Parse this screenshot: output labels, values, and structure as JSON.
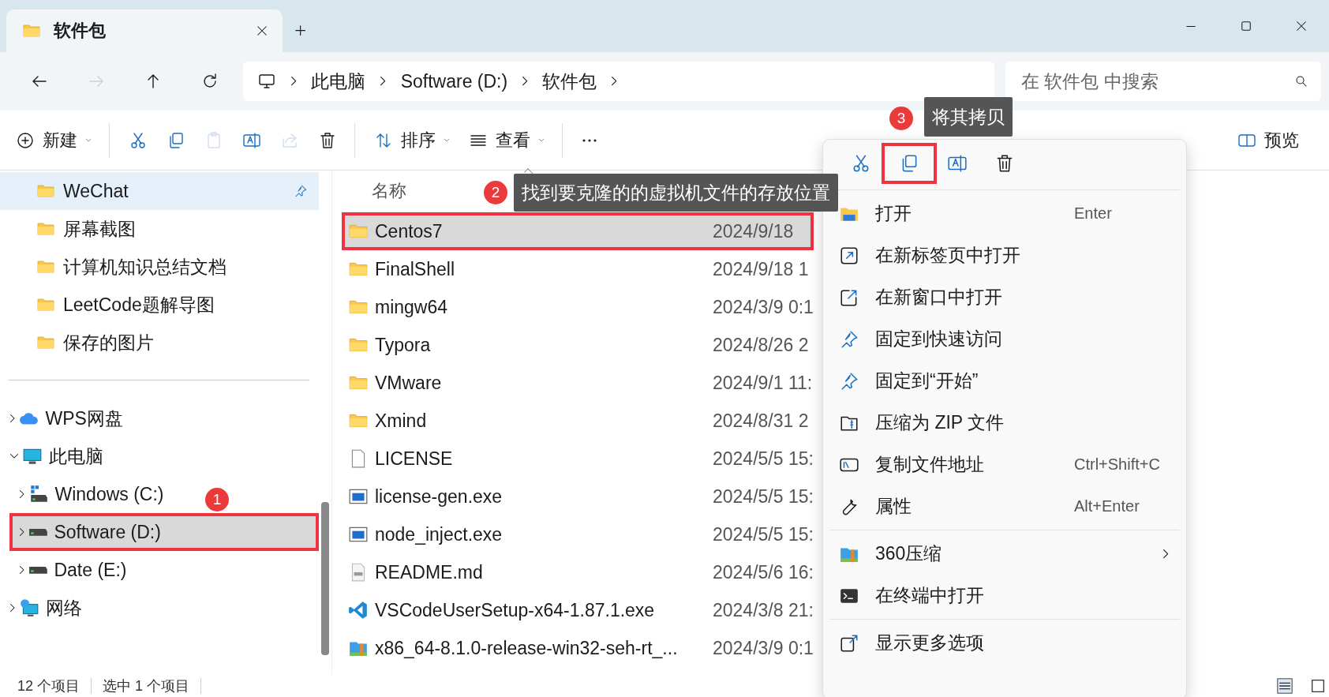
{
  "tabs": [
    {
      "label": "软件包",
      "selected": true
    }
  ],
  "address": {
    "segments": [
      "此电脑",
      "Software (D:)",
      "软件包"
    ],
    "search_placeholder": "在 软件包 中搜索"
  },
  "nav_buttons": [
    {
      "kind": "back",
      "disabled": false
    },
    {
      "kind": "forward",
      "disabled": true
    },
    {
      "kind": "up",
      "disabled": false
    },
    {
      "kind": "refresh",
      "disabled": false
    }
  ],
  "toolbar": [
    {
      "kind": "new",
      "label": "新建",
      "disabled": false
    },
    {
      "kind": "divider"
    },
    {
      "kind": "cut",
      "disabled": false
    },
    {
      "kind": "copy",
      "disabled": false
    },
    {
      "kind": "paste",
      "disabled": true
    },
    {
      "kind": "rename",
      "disabled": false
    },
    {
      "kind": "share",
      "disabled": true
    },
    {
      "kind": "delete",
      "disabled": false
    },
    {
      "kind": "divider"
    },
    {
      "kind": "sort",
      "label": "排序",
      "disabled": false
    },
    {
      "kind": "view",
      "label": "查看",
      "disabled": false
    },
    {
      "kind": "divider"
    },
    {
      "kind": "more",
      "disabled": false
    }
  ],
  "preview_button": {
    "label": "预览"
  },
  "sidebar": {
    "quick_access": [
      {
        "label": "WeChat",
        "pinned": true,
        "selected": true
      },
      {
        "label": "屏幕截图",
        "pinned": false,
        "selected": false
      },
      {
        "label": "计算机知识总结文档",
        "pinned": false,
        "selected": false
      },
      {
        "label": "LeetCode题解导图",
        "pinned": false,
        "selected": false
      },
      {
        "label": "保存的图片",
        "pinned": false,
        "selected": false
      }
    ],
    "tree": [
      {
        "label": "WPS网盘",
        "kind": "cloud",
        "expanded": false,
        "selected": false,
        "marked": false
      },
      {
        "label": "此电脑",
        "kind": "pc",
        "expanded": true,
        "selected": false,
        "marked": false,
        "children": [
          {
            "label": "Windows  (C:)",
            "kind": "system-drive",
            "expanded": false,
            "selected": false,
            "marked": false
          },
          {
            "label": "Software (D:)",
            "kind": "drive",
            "expanded": false,
            "selected": true,
            "marked": true,
            "callout": {
              "number": "1"
            }
          },
          {
            "label": "Date (E:)",
            "kind": "drive",
            "expanded": false,
            "selected": false,
            "marked": false
          }
        ]
      },
      {
        "label": "网络",
        "kind": "network",
        "expanded": false,
        "selected": false,
        "marked": false
      }
    ]
  },
  "file_list": {
    "columns": [
      "名称"
    ],
    "rows": [
      {
        "name": "Centos7",
        "kind": "folder",
        "date": "2024/9/18",
        "selected": true,
        "marked": true,
        "callout": {
          "number": "2",
          "text": "找到要克隆的的虚拟机文件的存放位置"
        }
      },
      {
        "name": "FinalShell",
        "kind": "folder",
        "date": "2024/9/18 1",
        "selected": false,
        "marked": false
      },
      {
        "name": "mingw64",
        "kind": "folder",
        "date": "2024/3/9 0:1",
        "selected": false,
        "marked": false
      },
      {
        "name": "Typora",
        "kind": "folder",
        "date": "2024/8/26 2",
        "selected": false,
        "marked": false
      },
      {
        "name": "VMware",
        "kind": "folder",
        "date": "2024/9/1 11:",
        "selected": false,
        "marked": false
      },
      {
        "name": "Xmind",
        "kind": "folder",
        "date": "2024/8/31 2",
        "selected": false,
        "marked": false
      },
      {
        "name": "LICENSE",
        "kind": "file",
        "date": "2024/5/5 15:",
        "selected": false,
        "marked": false
      },
      {
        "name": "license-gen.exe",
        "kind": "program",
        "date": "2024/5/5 15:",
        "selected": false,
        "marked": false
      },
      {
        "name": "node_inject.exe",
        "kind": "program",
        "date": "2024/5/5 15:",
        "selected": false,
        "marked": false
      },
      {
        "name": "README.md",
        "kind": "markdown",
        "date": "2024/5/6 16:",
        "selected": false,
        "marked": false
      },
      {
        "name": "VSCodeUserSetup-x64-1.87.1.exe",
        "kind": "installer",
        "date": "2024/3/8 21:",
        "selected": false,
        "marked": false
      },
      {
        "name": "x86_64-8.1.0-release-win32-seh-rt_...",
        "kind": "archive",
        "date": "2024/3/9 0:1",
        "selected": false,
        "marked": false
      }
    ]
  },
  "context_menu": {
    "actions": [
      {
        "kind": "cut",
        "marked": false
      },
      {
        "kind": "copy",
        "marked": true,
        "callout": {
          "number": "3",
          "text": "将其拷贝"
        }
      },
      {
        "kind": "rename",
        "marked": false
      },
      {
        "kind": "delete",
        "marked": false
      }
    ],
    "groups": [
      [
        {
          "kind": "open",
          "label": "打开",
          "shortcut": "Enter"
        },
        {
          "kind": "new-tab",
          "label": "在新标签页中打开"
        },
        {
          "kind": "new-window",
          "label": "在新窗口中打开"
        },
        {
          "kind": "pin",
          "label": "固定到快速访问"
        },
        {
          "kind": "pin",
          "label": "固定到“开始”"
        },
        {
          "kind": "zip",
          "label": "压缩为 ZIP 文件"
        },
        {
          "kind": "copy-path",
          "label": "复制文件地址",
          "shortcut": "Ctrl+Shift+C"
        },
        {
          "kind": "properties",
          "label": "属性",
          "shortcut": "Alt+Enter"
        }
      ],
      [
        {
          "kind": "compress",
          "label": "360压缩",
          "submenu": true
        },
        {
          "kind": "terminal",
          "label": "在终端中打开"
        }
      ],
      [
        {
          "kind": "more-options",
          "label": "显示更多选项"
        }
      ]
    ]
  },
  "status_bar": {
    "count": "12 个项目",
    "selection": "选中 1 个项目"
  }
}
